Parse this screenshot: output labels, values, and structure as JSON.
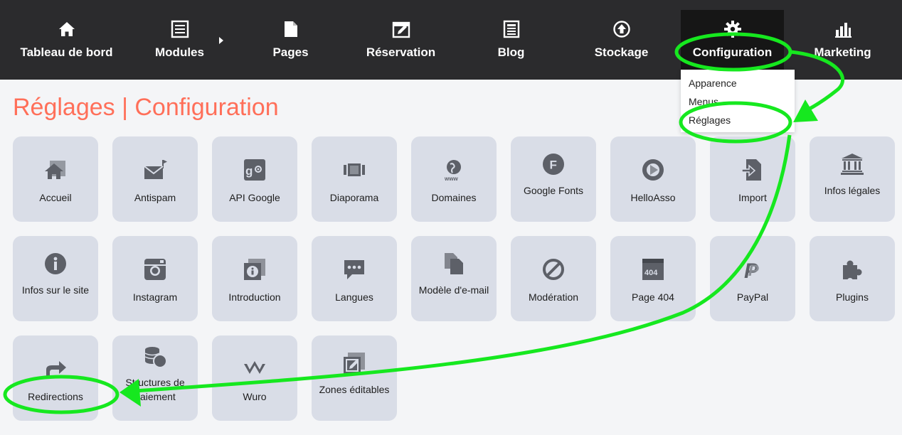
{
  "nav": {
    "items": [
      {
        "label": "Tableau de bord",
        "icon": "home-icon"
      },
      {
        "label": "Modules",
        "icon": "list-icon"
      },
      {
        "label": "Pages",
        "icon": "page-icon"
      },
      {
        "label": "Réservation",
        "icon": "calendar-edit-icon"
      },
      {
        "label": "Blog",
        "icon": "newspaper-icon"
      },
      {
        "label": "Stockage",
        "icon": "upload-circle-icon"
      },
      {
        "label": "Configuration",
        "icon": "gear-icon"
      },
      {
        "label": "Marketing",
        "icon": "bar-chart-icon"
      }
    ],
    "active": "Configuration"
  },
  "dropdown": {
    "items": [
      "Apparence",
      "Menus",
      "Réglages"
    ]
  },
  "page": {
    "title": "Réglages | Configuration"
  },
  "tiles": [
    {
      "label": "Accueil",
      "icon": "home-icon"
    },
    {
      "label": "Antispam",
      "icon": "mail-flag-icon"
    },
    {
      "label": "API Google",
      "icon": "google-plus-icon"
    },
    {
      "label": "Diaporama",
      "icon": "slideshow-icon"
    },
    {
      "label": "Domaines",
      "icon": "globe-www-icon"
    },
    {
      "label": "Google Fonts",
      "icon": "font-f-icon"
    },
    {
      "label": "HelloAsso",
      "icon": "helloasso-icon"
    },
    {
      "label": "Import",
      "icon": "import-icon"
    },
    {
      "label": "Infos légales",
      "icon": "bank-icon"
    },
    {
      "label": "Infos sur le site",
      "icon": "info-icon"
    },
    {
      "label": "Instagram",
      "icon": "instagram-icon"
    },
    {
      "label": "Introduction",
      "icon": "info-stack-icon"
    },
    {
      "label": "Langues",
      "icon": "speech-bubble-icon"
    },
    {
      "label": "Modèle d'e-mail",
      "icon": "copy-icon"
    },
    {
      "label": "Modération",
      "icon": "ban-icon"
    },
    {
      "label": "Page 404",
      "icon": "page-404-icon"
    },
    {
      "label": "PayPal",
      "icon": "paypal-icon"
    },
    {
      "label": "Plugins",
      "icon": "puzzle-icon"
    },
    {
      "label": "Redirections",
      "icon": "share-icon"
    },
    {
      "label": "Structures de paiement",
      "icon": "coins-icon"
    },
    {
      "label": "Wuro",
      "icon": "wuro-icon"
    },
    {
      "label": "Zones éditables",
      "icon": "edit-stack-icon"
    }
  ],
  "colors": {
    "nav_bg": "#2b2b2d",
    "nav_active_bg": "#161616",
    "title": "#ff6f59",
    "tile_bg": "#d9dde7",
    "icon": "#5d6068",
    "annotation": "#16e81f"
  }
}
